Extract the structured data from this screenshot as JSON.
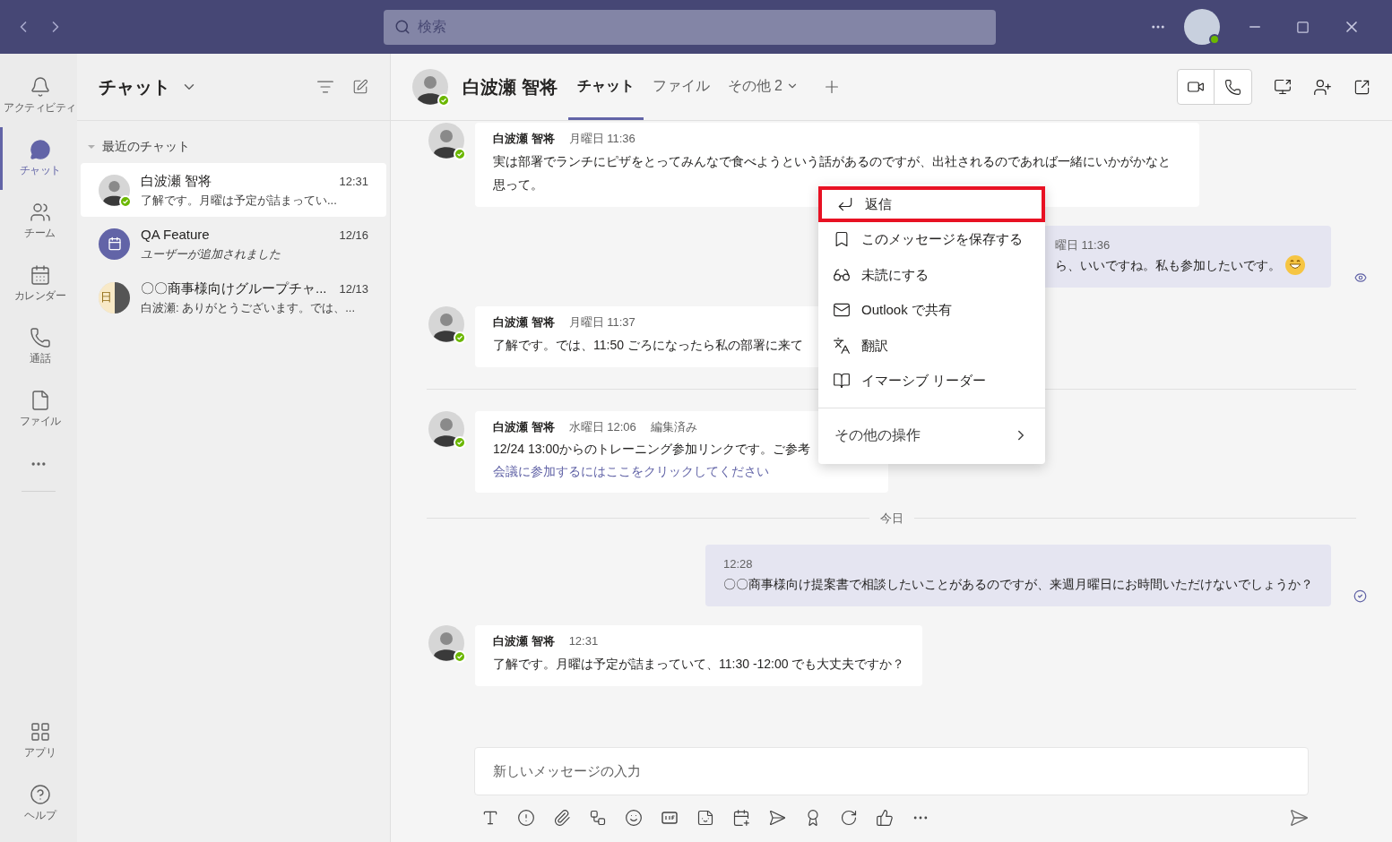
{
  "titlebar": {
    "search": {
      "placeholder": "検索"
    }
  },
  "rail": {
    "items": [
      {
        "label": "アクティビティ",
        "selected": false
      },
      {
        "label": "チャット",
        "selected": true
      },
      {
        "label": "チーム",
        "selected": false
      },
      {
        "label": "カレンダー",
        "selected": false
      },
      {
        "label": "通話",
        "selected": false
      },
      {
        "label": "ファイル",
        "selected": false
      }
    ],
    "bottom_items": [
      {
        "label": "アプリ",
        "selected": false
      },
      {
        "label": "ヘルプ",
        "selected": false
      }
    ]
  },
  "chat_list": {
    "title": "チャット",
    "section": {
      "label": "最近のチャット",
      "expanded": true
    },
    "items": [
      {
        "kind": "person",
        "name": "白波瀬 智将",
        "time": "12:31",
        "preview": "了解です。月曜は予定が詰まってい...",
        "preview_italic": false,
        "selected": true
      },
      {
        "kind": "meeting",
        "name": "QA Feature",
        "time": "12/16",
        "preview": "ユーザーが追加されました",
        "preview_italic": true,
        "selected": false
      },
      {
        "kind": "group",
        "name": "〇〇商事様向けグループチャ...",
        "time": "12/13",
        "preview": "白波瀬: ありがとうございます。では、...",
        "preview_italic": false,
        "selected": false,
        "initial": "日"
      }
    ]
  },
  "conversation": {
    "name": "白波瀬 智将",
    "tabs": [
      {
        "label": "チャット",
        "selected": true,
        "dropdown": false
      },
      {
        "label": "ファイル",
        "selected": false,
        "dropdown": false
      },
      {
        "label": "その他 2",
        "selected": false,
        "dropdown": true
      }
    ],
    "messages": [
      {
        "kind": "incoming",
        "author": "白波瀬 智将",
        "time": "月曜日 11:36",
        "text": "実は部署でランチにピザをとってみんなで食べようという話があるのですが、出社されるのであれば一緒にいかがかなと思って。",
        "covered": false
      },
      {
        "kind": "outgoing",
        "time": "曜日 11:36",
        "text": "ら、いいですね。私も参加したいです。",
        "emoji": true,
        "read": true,
        "covered": true
      },
      {
        "kind": "incoming",
        "author": "白波瀬 智将",
        "time": "月曜日 11:37",
        "text": "了解です。では、11:50 ごろになったら私の部署に来て",
        "covered": true
      },
      {
        "kind": "divider"
      },
      {
        "kind": "incoming",
        "author": "白波瀬 智将",
        "time": "水曜日 12:06",
        "edited": "編集済み",
        "text": "12/24 13:00からのトレーニング参加リンクです。ご参考",
        "link": "会議に参加するにはここをクリックしてください",
        "covered": true
      },
      {
        "kind": "divider",
        "label": "今日"
      },
      {
        "kind": "outgoing",
        "time": "12:28",
        "text": "〇〇商事様向け提案書で相談したいことがあるのですが、来週月曜日にお時間いただけないでしょうか？",
        "emoji": false,
        "read": false,
        "covered": false
      },
      {
        "kind": "incoming",
        "author": "白波瀬 智将",
        "time": "12:31",
        "text": "了解です。月曜は予定が詰まっていて、11:30 -12:00 でも大丈夫ですか？",
        "covered": false
      }
    ],
    "compose": {
      "placeholder": "新しいメッセージの入力"
    }
  },
  "context_menu": {
    "items": [
      {
        "label": "返信",
        "highlighted": true
      },
      {
        "label": "このメッセージを保存する",
        "highlighted": false
      },
      {
        "label": "未読にする",
        "highlighted": false
      },
      {
        "label": "Outlook で共有",
        "highlighted": false
      },
      {
        "label": "翻訳",
        "highlighted": false
      },
      {
        "label": "イマーシブ リーダー",
        "highlighted": false
      }
    ],
    "more": {
      "label": "その他の操作"
    }
  }
}
